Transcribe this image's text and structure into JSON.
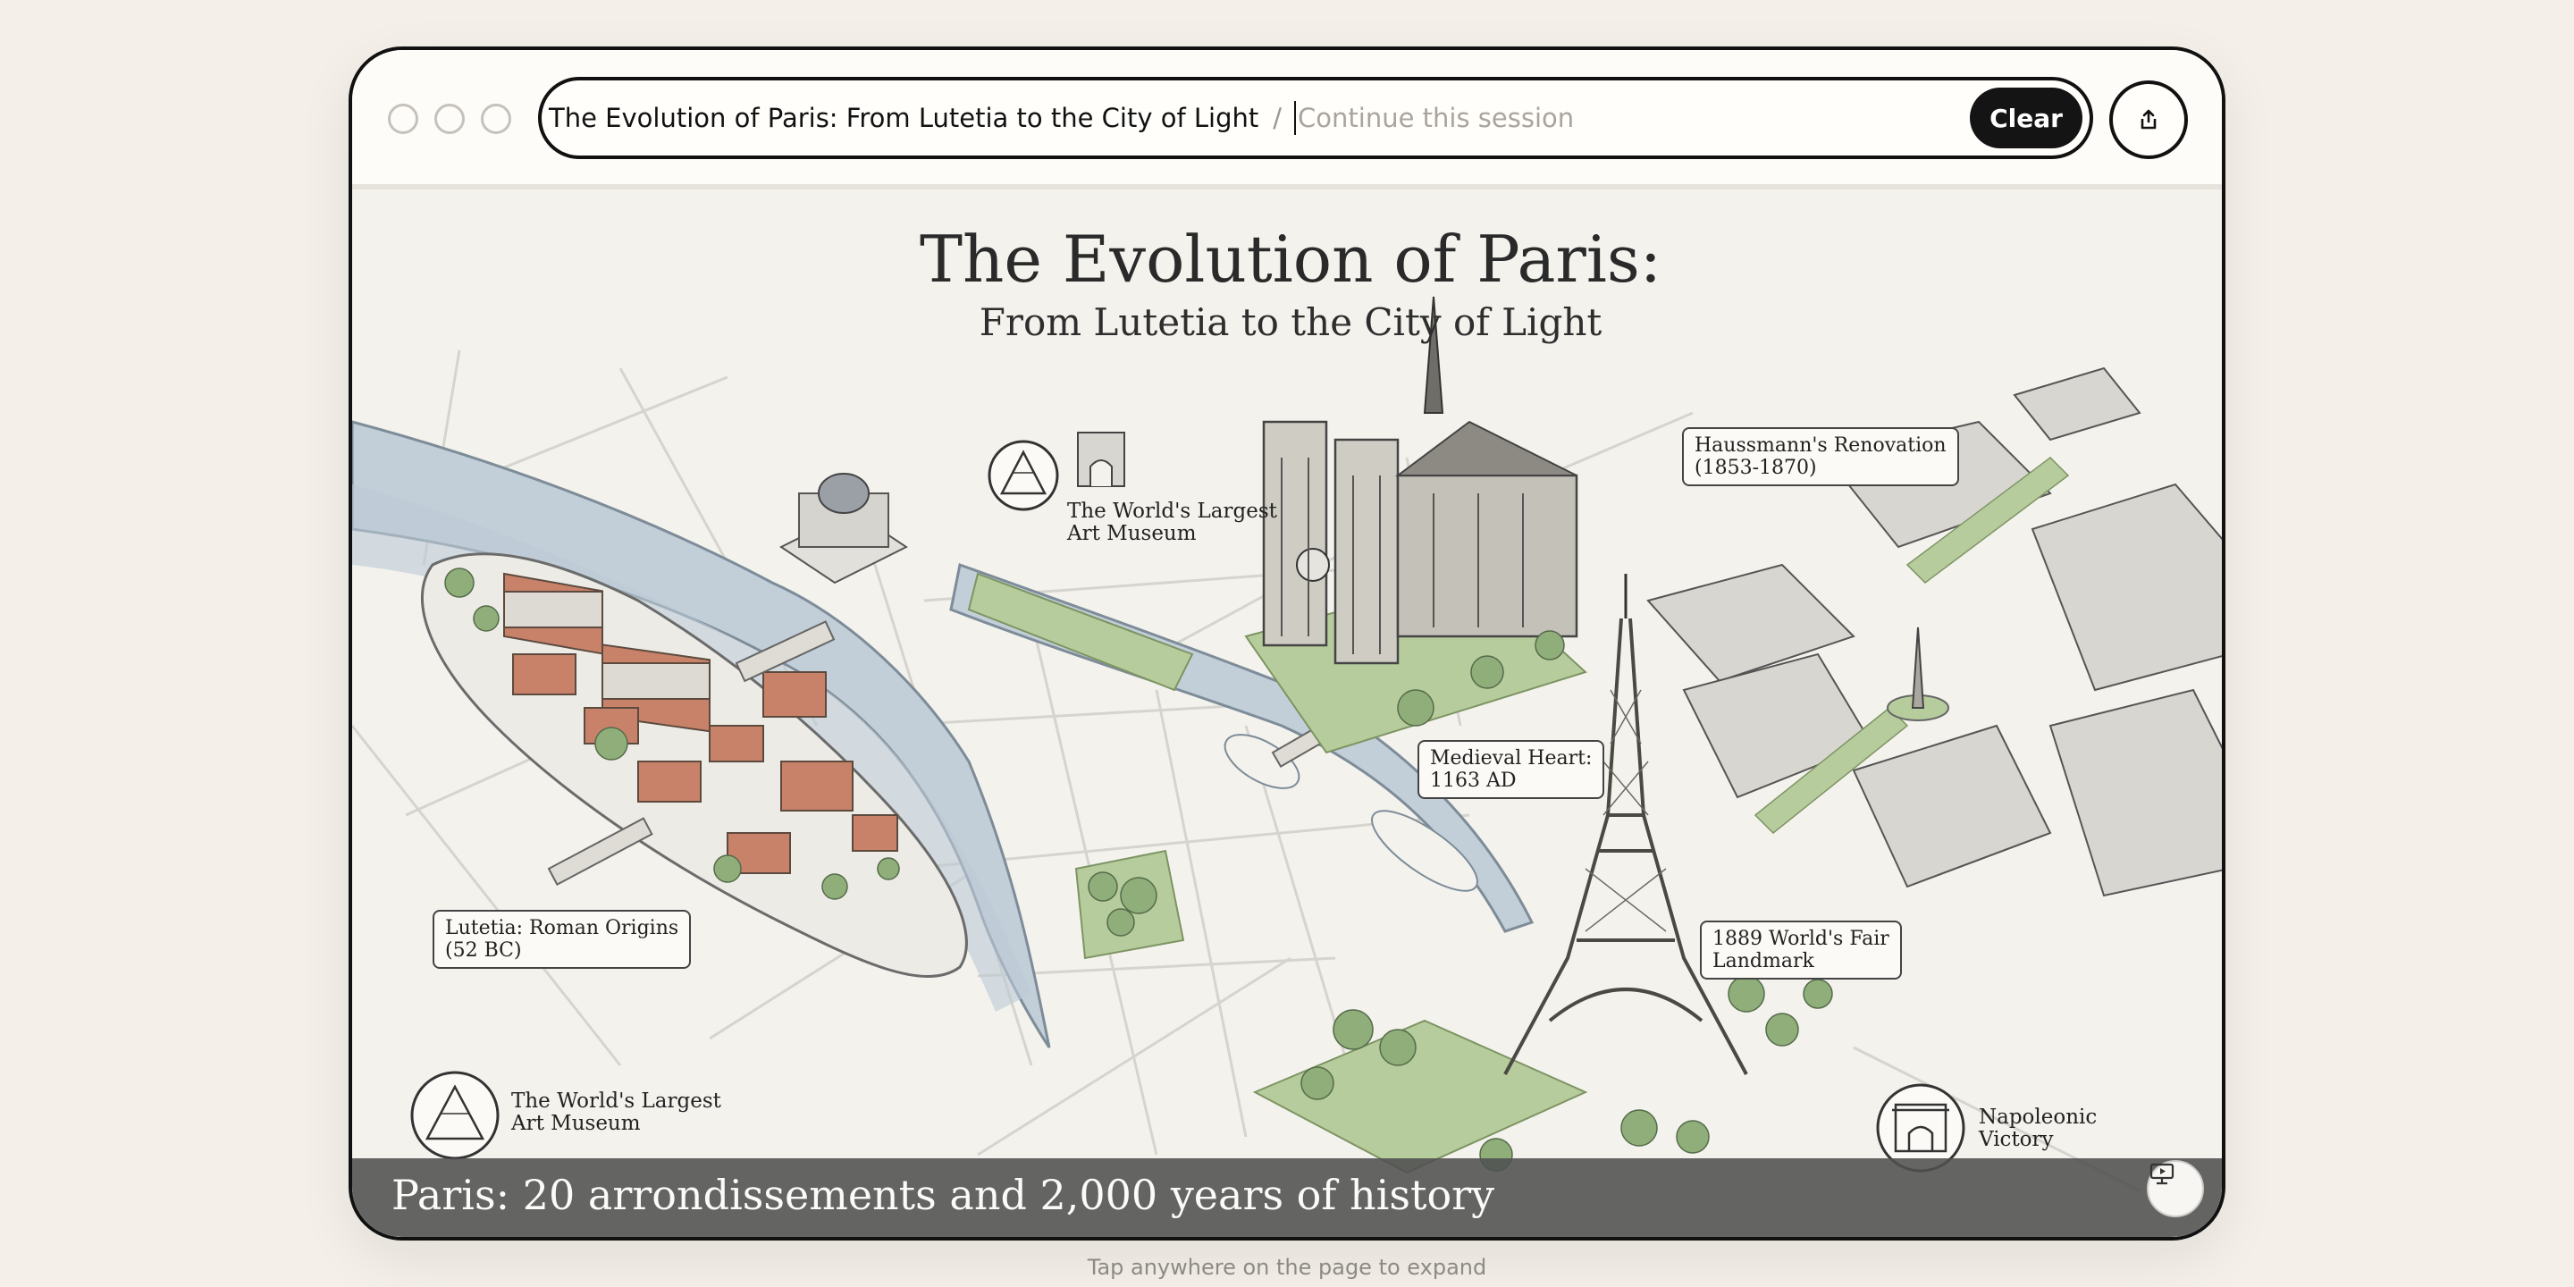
{
  "window": {
    "session_title": "The Evolution of Paris: From Lutetia to the City of Light",
    "separator": "/",
    "input_placeholder": "Continue this session",
    "clear_label": "Clear",
    "share_icon": "share-icon"
  },
  "slide": {
    "title": "The Evolution of Paris:",
    "subtitle": "From Lutetia to the City of Light",
    "labels": {
      "museum_top_line1": "The World's Largest",
      "museum_top_line2": "Art Museum",
      "haussmann_line1": "Haussmann's Renovation",
      "haussmann_line2": "(1853-1870)",
      "medieval_line1": "Medieval Heart:",
      "medieval_line2": "1163 AD",
      "lutetia_line1": "Lutetia: Roman Origins",
      "lutetia_line2": "(52 BC)",
      "fair_line1": "1889 World's Fair",
      "fair_line2": "Landmark",
      "museum_bottom_line1": "The World's Largest",
      "museum_bottom_line2": "Art Museum",
      "napoleon_line1": "Napoleonic",
      "napoleon_line2": "Victory"
    },
    "caption": "Paris: 20 arrondissements and 2,000 years of history",
    "present_icon": "presentation-icon"
  },
  "footer": {
    "hint": "Tap anywhere on the page to expand"
  },
  "colors": {
    "river": "#c2cfd9",
    "park": "#b7cc9c",
    "roof": "#c9826a",
    "building": "#d8d6d0",
    "caption_bar": "#505050"
  }
}
